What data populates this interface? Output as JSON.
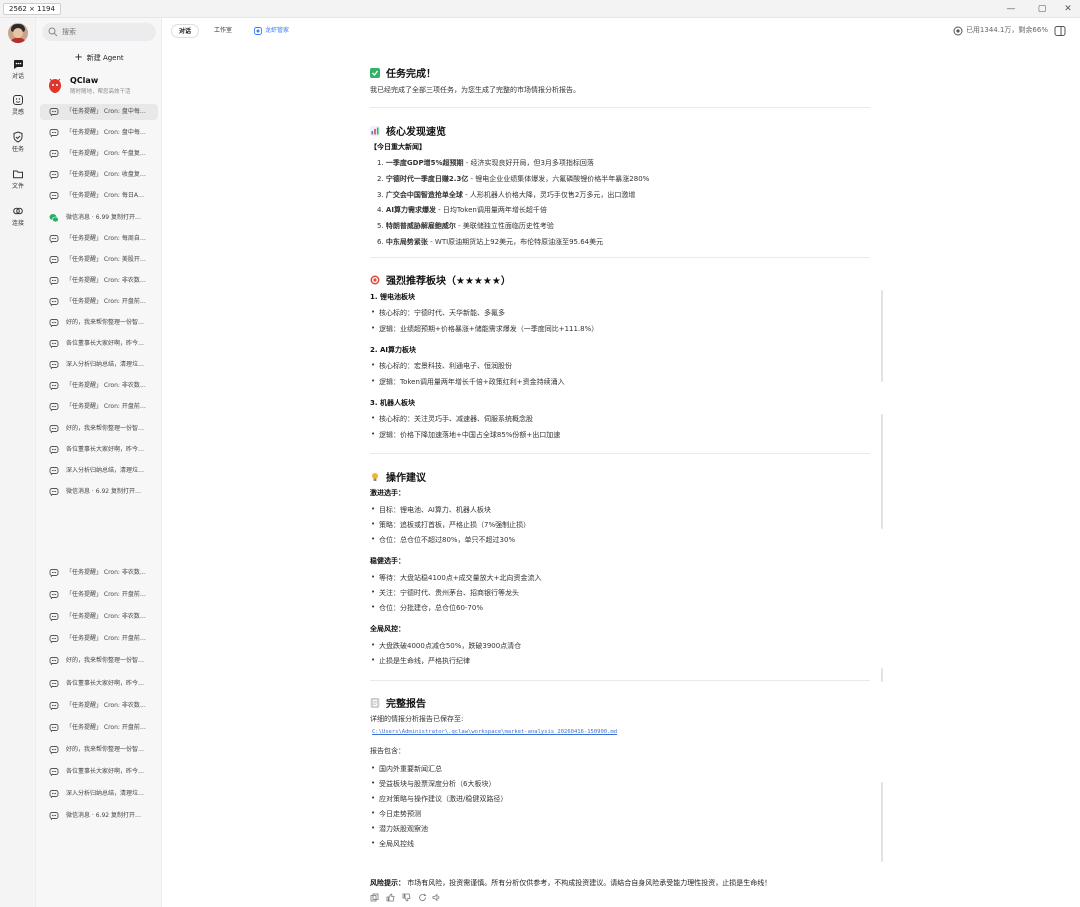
{
  "window": {
    "size_tag": "2562 × 1194",
    "controls": [
      "—",
      "▢",
      "✕"
    ]
  },
  "rail": [
    {
      "label": "对话",
      "icon": "chat-icon"
    },
    {
      "label": "灵感",
      "icon": "inspiration-icon"
    },
    {
      "label": "任务",
      "icon": "task-icon"
    },
    {
      "label": "文件",
      "icon": "folder-icon"
    },
    {
      "label": "连接",
      "icon": "link-icon"
    }
  ],
  "sidebar": {
    "search_placeholder": "搜索",
    "new_agent": "新建 Agent",
    "qclaw": {
      "name": "QClaw",
      "subtitle": "随时随地，帮您高效干活"
    },
    "conversations": [
      {
        "text": "「任务提醒」 Cron: 盘中每…",
        "icon": "chat"
      },
      {
        "text": "「任务提醒」 Cron: 盘中每…",
        "icon": "chat"
      },
      {
        "text": "「任务提醒」 Cron: 午盘复…",
        "icon": "chat"
      },
      {
        "text": "「任务提醒」 Cron: 收盘复…",
        "icon": "chat"
      },
      {
        "text": "「任务提醒」 Cron: 每日A…",
        "icon": "chat"
      },
      {
        "text": "微信消息 · 6.99 复制打开…",
        "icon": "wechat"
      },
      {
        "text": "「任务提醒」 Cron: 每周自…",
        "icon": "chat"
      },
      {
        "text": "「任务提醒」 Cron: 美股开…",
        "icon": "chat"
      },
      {
        "text": "「任务提醒」 Cron: 非农数…",
        "icon": "chat"
      },
      {
        "text": "「任务提醒」 Cron: 开盘前…",
        "icon": "chat"
      },
      {
        "text": "好的，我来帮你整理一份智…",
        "icon": "chat"
      },
      {
        "text": "各位董事长大家好啊，昨今…",
        "icon": "chat"
      },
      {
        "text": "深入分析归纳总结，清理垃…",
        "icon": "chat"
      },
      {
        "text": "「任务提醒」 Cron: 非农数…",
        "icon": "chat"
      },
      {
        "text": "「任务提醒」 Cron: 开盘前…",
        "icon": "chat"
      },
      {
        "text": "好的，我来帮你整理一份智…",
        "icon": "chat"
      },
      {
        "text": "各位董事长大家好啊，昨今…",
        "icon": "chat"
      },
      {
        "text": "深入分析归纳总结，清理垃…",
        "icon": "chat"
      },
      {
        "text": "微信消息 · 6.92 复制打开…",
        "icon": "chat"
      }
    ],
    "conversations_lower": [
      {
        "text": "「任务提醒」 Cron: 非农数…",
        "icon": "chat"
      },
      {
        "text": "「任务提醒」 Cron: 开盘前…",
        "icon": "chat"
      },
      {
        "text": "「任务提醒」 Cron: 非农数…",
        "icon": "chat"
      },
      {
        "text": "「任务提醒」 Cron: 开盘前…",
        "icon": "chat"
      },
      {
        "text": "好的，我来帮你整理一份智…",
        "icon": "chat"
      },
      {
        "text": "各位董事长大家好啊，昨今…",
        "icon": "chat"
      },
      {
        "text": "「任务提醒」 Cron: 非农数…",
        "icon": "chat"
      },
      {
        "text": "「任务提醒」 Cron: 开盘前…",
        "icon": "chat"
      },
      {
        "text": "好的，我来帮你整理一份智…",
        "icon": "chat"
      },
      {
        "text": "各位董事长大家好啊，昨今…",
        "icon": "chat"
      },
      {
        "text": "深入分析归纳总结，清理垃…",
        "icon": "chat"
      },
      {
        "text": "微信消息 · 6.92 复制打开…",
        "icon": "chat"
      }
    ]
  },
  "topbar": {
    "tabs": [
      "对话",
      "工作室",
      "龙虾管家"
    ],
    "usage": "已用1344.1万，剩余66%"
  },
  "content": {
    "done_title": "任务完成！",
    "done_text": "我已经完成了全部三项任务，为您生成了完整的市场情报分析报告。",
    "core_title": "核心发现速览",
    "news_label": "【今日重大新闻】",
    "news": [
      {
        "n": "1.",
        "b": "一季度GDP增5%超预期",
        "t": " - 经济实现良好开局，但3月多项指标回落"
      },
      {
        "n": "2.",
        "b": "宁德时代一季度日赚2.3亿",
        "t": " - 锂电企业业绩集体爆发，六氟磷酸锂价格半年暴涨280%"
      },
      {
        "n": "3.",
        "b": "广交会中国智造抢单全球",
        "t": " - 人形机器人价格大降，灵巧手仅售2万多元，出口激增"
      },
      {
        "n": "4.",
        "b": "AI算力需求爆发",
        "t": " - 日均Token调用量两年增长超千倍"
      },
      {
        "n": "5.",
        "b": "特朗普威胁解雇鲍威尔",
        "t": " - 美联储独立性面临历史性考验"
      },
      {
        "n": "6.",
        "b": "中东局势紧张",
        "t": " - WTI原油期货站上92美元，布伦特原油涨至95.64美元"
      }
    ],
    "rec_title": "强烈推荐板块（★★★★★）",
    "sectors": [
      {
        "name": "1. 锂电池板块",
        "target": "核心标的：宁德时代、天华新能、多氟多",
        "logic": "逻辑：业绩超预期+价格暴涨+储能需求爆发（一季度同比+111.8%）"
      },
      {
        "name": "2. AI算力板块",
        "target": "核心标的：宏景科技、利通电子、恒润股份",
        "logic": "逻辑：Token调用量两年增长千倍+政策红利+资金持续涌入"
      },
      {
        "name": "3. 机器人板块",
        "target": "核心标的：关注灵巧手、减速器、伺服系统概念股",
        "logic": "逻辑：价格下降加速落地+中国占全球85%份额+出口加速"
      }
    ],
    "ops_title": "操作建议",
    "aggressive": {
      "label": "激进选手：",
      "items": [
        "目标：锂电池、AI算力、机器人板块",
        "策略：追板或打首板，严格止损（7%强制止损）",
        "仓位：总仓位不超过80%，单只不超过30%"
      ]
    },
    "steady": {
      "label": "稳健选手：",
      "items": [
        "等待：大盘站稳4100点+成交量放大+北向资金流入",
        "关注：宁德时代、贵州茅台、招商银行等龙头",
        "仓位：分批建仓，总仓位60-70%"
      ]
    },
    "risk_ctl": {
      "label": "全局风控：",
      "items": [
        "大盘跌破4000点减仓50%，跌破3900点清仓",
        "止损是生命线，严格执行纪律"
      ]
    },
    "report_title": "完整报告",
    "report_saved": "详细的情报分析报告已保存至:",
    "report_path": "C:\\Users\\Administrator\\.qclaw\\workspace\\market-analysis_20260416-150900.md",
    "report_includes": "报告包含：",
    "report_items": [
      "国内外重要新闻汇总",
      "受益板块与股票深度分析（6大板块）",
      "应对策略与操作建议（激进/稳健双路径）",
      "今日走势预测",
      "潜力妖股观察池",
      "全局风控线"
    ],
    "risk_label": "风险提示：",
    "risk_text": "市场有风险，投资需谨慎。所有分析仅供参考，不构成投资建议。请结合自身风险承受能力理性投资，止损是生命线！"
  },
  "colors": {
    "accent": "#3b7bf5",
    "check": "#2fb463",
    "chart": "#6b6fd6",
    "target": "#e0483a",
    "bulb": "#f2b52b"
  }
}
